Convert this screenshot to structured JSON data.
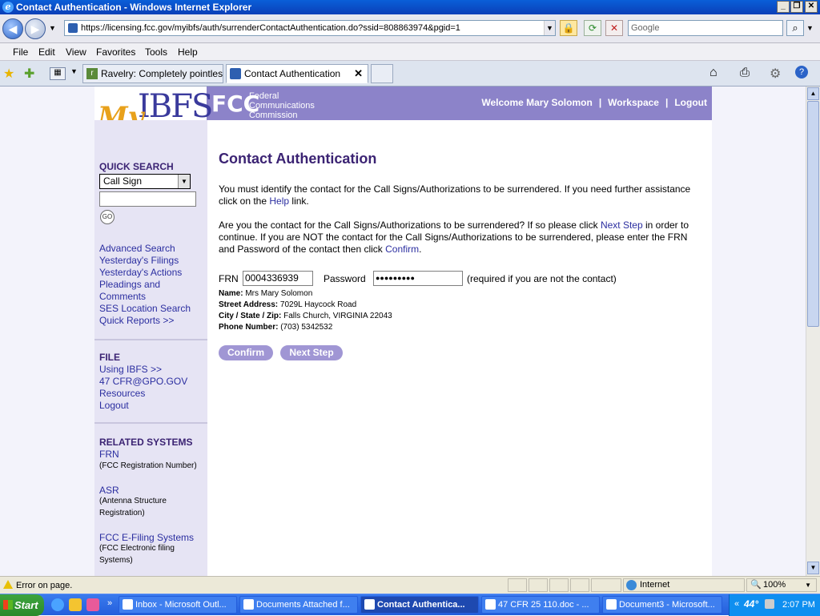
{
  "window": {
    "title": "Contact Authentication - Windows Internet Explorer"
  },
  "addressbar": {
    "url": "https://licensing.fcc.gov/myibfs/auth/surrenderContactAuthentication.do?ssid=808863974&pgid=1",
    "search_placeholder": "Google"
  },
  "menu": [
    "File",
    "Edit",
    "View",
    "Favorites",
    "Tools",
    "Help"
  ],
  "tabs": [
    {
      "label": "Ravelry: Completely pointles..."
    },
    {
      "label": "Contact Authentication"
    }
  ],
  "header": {
    "logo_my": "My",
    "logo_ibfs": "IBFS",
    "fcc_mark": "FCC",
    "fcc_name": [
      "Federal",
      "Communications",
      "Commission"
    ],
    "welcome": "Welcome Mary Solomon",
    "workspace": "Workspace",
    "logout": "Logout",
    "sep": "|"
  },
  "sidebar": {
    "quick_search_title": "QUICK SEARCH",
    "select_value": "Call Sign",
    "go_label": "GO",
    "links1": [
      "Advanced Search",
      "Yesterday's Filings",
      "Yesterday's Actions",
      "Pleadings and",
      "Comments",
      "SES Location Search",
      "Quick Reports >>"
    ],
    "file_title": "FILE",
    "links2": [
      "Using IBFS >>",
      "47 CFR@GPO.GOV",
      "Resources",
      "Logout"
    ],
    "related_title": "RELATED SYSTEMS",
    "frn": "FRN",
    "frn_sub": "(FCC Registration Number)",
    "asr": "ASR",
    "asr_sub1": "(Antenna Structure",
    "asr_sub2": "Registration)",
    "efiling": "FCC E-Filing Systems",
    "efiling_sub1": "(FCC Electronic filing",
    "efiling_sub2": "Systems)"
  },
  "main": {
    "title": "Contact Authentication",
    "p1_a": "You must identify the contact for the Call Signs/Authorizations to be surrendered. If you need further assistance click on the ",
    "p1_link": "Help",
    "p1_b": " link.",
    "p2_a": "Are you the contact for the Call Signs/Authorizations to be surrendered? If so please click ",
    "p2_link1": "Next Step",
    "p2_b": " in order to continue. If you are NOT the contact for the Call Signs/Authorizations to be surrendered, please enter the FRN and Password of the contact then click ",
    "p2_link2": "Confirm",
    "p2_c": ".",
    "frn_label": "FRN",
    "frn_value": "0004336939",
    "password_label": "Password",
    "password_value": "●●●●●●●●●",
    "required_note": "(required if you are not the contact)",
    "name_label": "Name:",
    "name_value": " Mrs Mary Solomon",
    "street_label": "Street Address:",
    "street_value": " 7029L Haycock Road",
    "city_label": "City / State / Zip:",
    "city_value": " Falls Church, VIRGINIA 22043",
    "phone_label": "Phone Number:",
    "phone_value": " (703) 5342532",
    "confirm_btn": "Confirm",
    "next_btn": "Next Step"
  },
  "statusbar": {
    "text": "Error on page.",
    "zone": "Internet",
    "zoom": "100%"
  },
  "taskbar": {
    "start": "Start",
    "tasks": [
      "Inbox - Microsoft Outl...",
      "Documents Attached f...",
      "Contact Authentica...",
      "47 CFR 25 110.doc - ...",
      "Document3 - Microsoft..."
    ],
    "temp": "44°",
    "clock": "2:07 PM"
  }
}
